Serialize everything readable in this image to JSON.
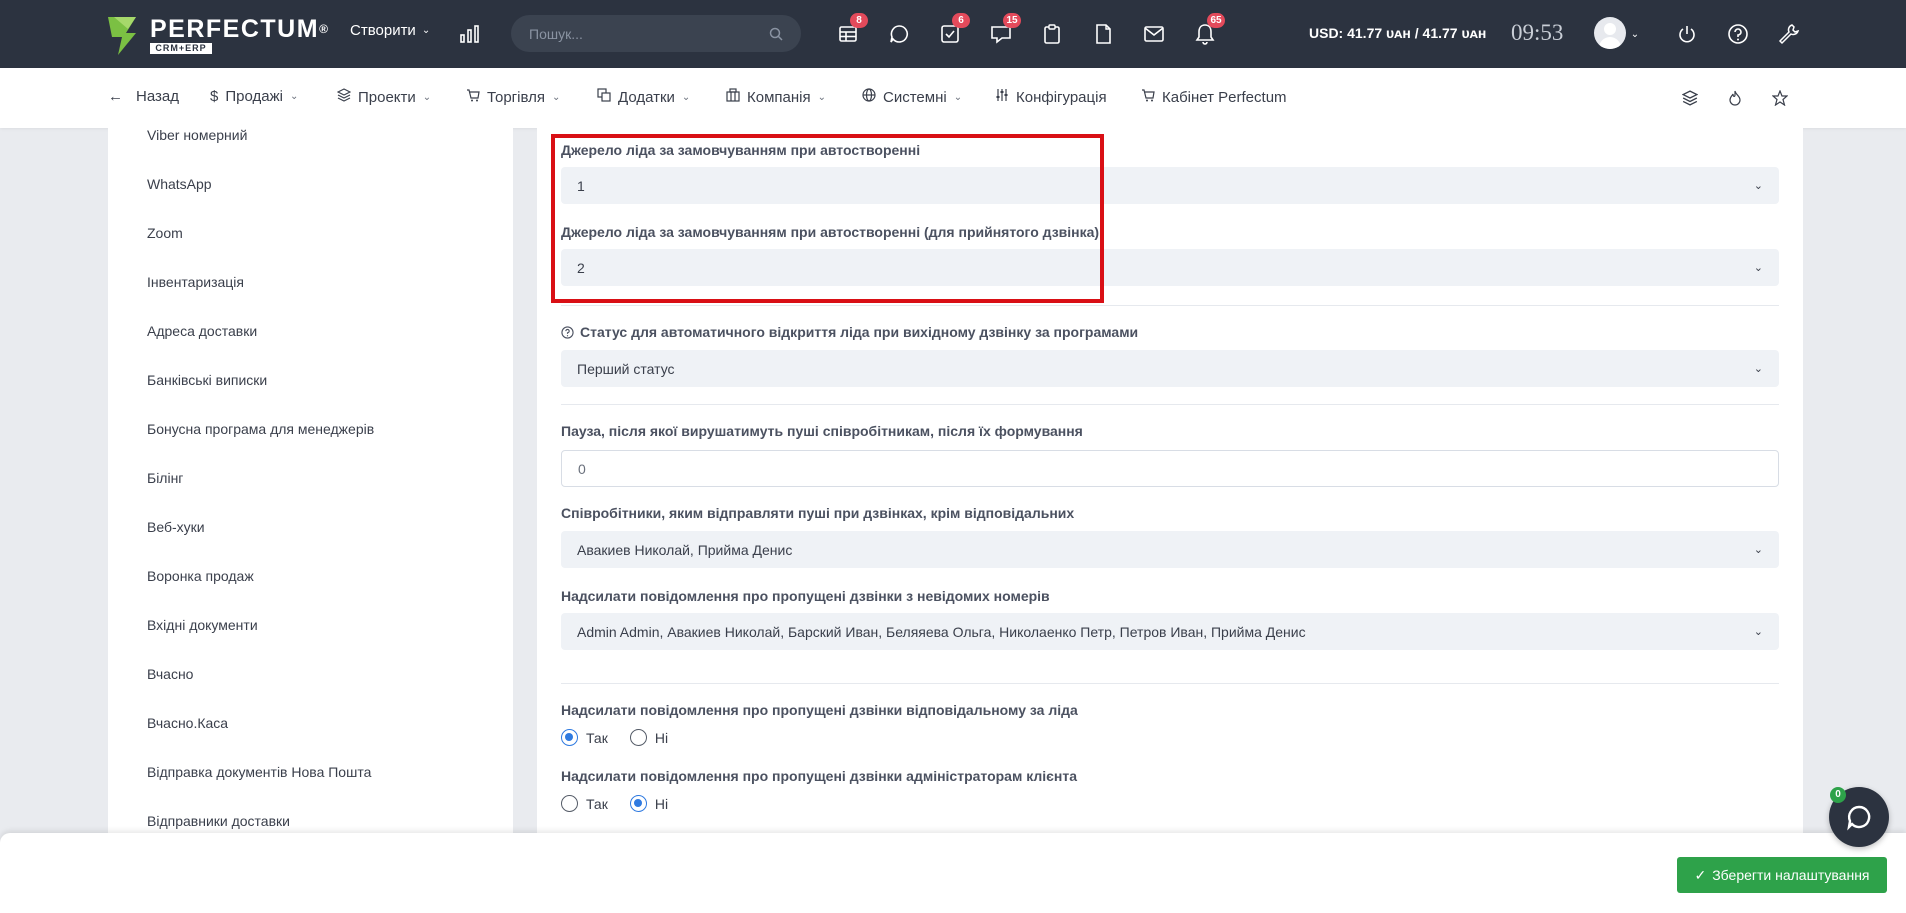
{
  "header": {
    "logo_name": "PERFECTUM",
    "logo_reg": "®",
    "logo_sub": "CRM+ERP",
    "create_label": "Створити",
    "search_placeholder": "Пошук...",
    "badges": {
      "tasks": "8",
      "checklist": "6",
      "messages": "15",
      "notifications": "65"
    },
    "currency": "USD: 41.77 ᴜᴀʜ / 41.77 ᴜᴀʜ",
    "clock": "09:53"
  },
  "nav": {
    "back": "Назад",
    "items": [
      "Продажі",
      "Проекти",
      "Торгівля",
      "Додатки",
      "Компанія",
      "Системні",
      "Конфігурація",
      "Кабінет Perfectum"
    ]
  },
  "sidebar": {
    "items": [
      "Viber номерний",
      "WhatsApp",
      "Zoom",
      "Інвентаризація",
      "Адреса доставки",
      "Банківські виписки",
      "Бонусна програма для менеджерів",
      "Білінг",
      "Веб-хуки",
      "Воронка продаж",
      "Вхідні документи",
      "Вчасно",
      "Вчасно.Каса",
      "Відправка документів Нова Пошта",
      "Відправники доставки"
    ]
  },
  "form": {
    "lead_source_label": "Джерело ліда за замовчуванням при автостворенні",
    "lead_source_value": "1",
    "lead_source_accepted_label": "Джерело ліда за замовчуванням при автостворенні (для прийнятого дзвінка)",
    "lead_source_accepted_value": "2",
    "status_label": "Статус для автоматичного відкриття ліда при вихідному дзвінку за програмами",
    "status_value": "Перший статус",
    "pause_label": "Пауза, після якої вирушатимуть пуші співробітникам, після їх формування",
    "pause_value": "0",
    "employees_label": "Співробітники, яким відправляти пуші при дзвінках, крім відповідальних",
    "employees_value": "Авакиев Николай, Прийма Денис",
    "missed_unknown_label": "Надсилати повідомлення про пропущені дзвінки з невідомих номерів",
    "missed_unknown_value": "Admin Admin, Авакиев Николай, Барский Иван, Беляяева Ольга, Николаенко Петр, Петров Иван, Прийма Денис",
    "missed_responsible_label": "Надсилати повідомлення про пропущені дзвінки відповідальному за ліда",
    "missed_admins_label": "Надсилати повідомлення про пропущені дзвінки адміністраторам клієнта",
    "yes": "Так",
    "no": "Ні"
  },
  "footer": {
    "save_label": "Зберегти налаштування",
    "chat_badge": "0"
  },
  "colors": {
    "topbar": "#2c3340",
    "highlight": "#d90f15",
    "save": "#2ea24a",
    "radio_checked": "#2f7ae0",
    "badge": "#e34a5b"
  }
}
